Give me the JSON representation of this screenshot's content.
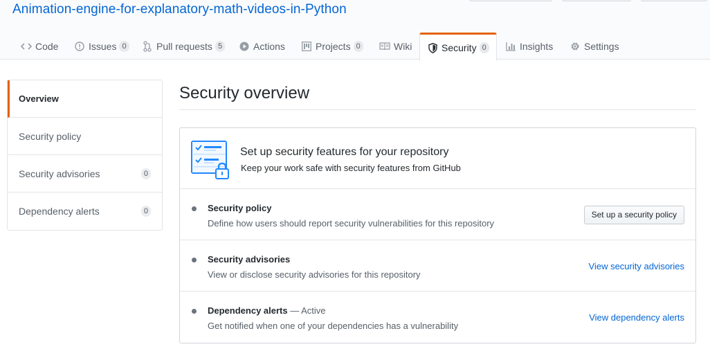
{
  "repo": {
    "title": "Animation-engine-for-explanatory-math-videos-in-Python"
  },
  "tabs": [
    {
      "label": "Code",
      "icon": "code-icon",
      "count": null
    },
    {
      "label": "Issues",
      "icon": "issue-icon",
      "count": "0"
    },
    {
      "label": "Pull requests",
      "icon": "pull-request-icon",
      "count": "5"
    },
    {
      "label": "Actions",
      "icon": "play-icon",
      "count": null
    },
    {
      "label": "Projects",
      "icon": "project-icon",
      "count": "0"
    },
    {
      "label": "Wiki",
      "icon": "book-icon",
      "count": null
    },
    {
      "label": "Security",
      "icon": "shield-icon",
      "count": "0",
      "selected": true
    },
    {
      "label": "Insights",
      "icon": "graph-icon",
      "count": null
    },
    {
      "label": "Settings",
      "icon": "gear-icon",
      "count": null
    }
  ],
  "sidebar": {
    "items": [
      {
        "label": "Overview",
        "active": true
      },
      {
        "label": "Security policy"
      },
      {
        "label": "Security advisories",
        "count": "0"
      },
      {
        "label": "Dependency alerts",
        "count": "0"
      }
    ]
  },
  "main": {
    "title": "Security overview",
    "setup": {
      "title": "Set up security features for your repository",
      "subtitle": "Keep your work safe with security features from GitHub",
      "icon": "checklist-lock-icon"
    },
    "features": [
      {
        "title": "Security policy",
        "status": "",
        "description": "Define how users should report security vulnerabilities for this repository",
        "action": "Set up a security policy",
        "action_type": "button"
      },
      {
        "title": "Security advisories",
        "status": "",
        "description": "View or disclose security advisories for this repository",
        "action": "View security advisories",
        "action_type": "link"
      },
      {
        "title": "Dependency alerts",
        "status": "— Active",
        "description": "Get notified when one of your dependencies has a vulnerability",
        "action": "View dependency alerts",
        "action_type": "link"
      }
    ]
  },
  "colors": {
    "accent": "#e36209",
    "link": "#0366d6",
    "illustration_blue": "#2188ff",
    "illustration_light": "#c8e1ff"
  }
}
